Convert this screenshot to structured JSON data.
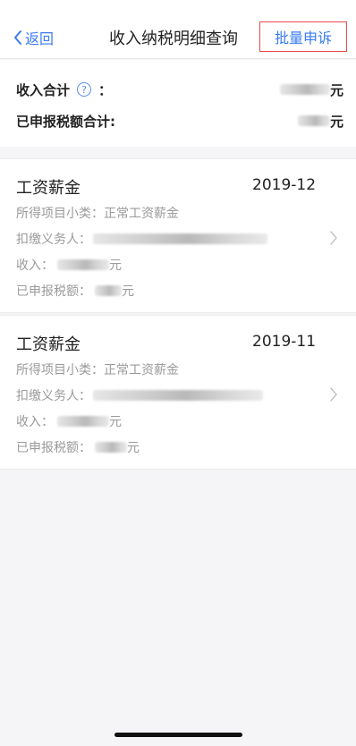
{
  "navbar": {
    "back_label": "返回",
    "title": "收入纳税明细查询",
    "action_label": "批量申诉"
  },
  "summary": {
    "income_total_label": "收入合计",
    "help_symbol": "?",
    "colon": "：",
    "declared_tax_total_label": "已申报税额合计:",
    "currency_unit": "元"
  },
  "records": [
    {
      "category": "工资薪金",
      "period": "2019-12",
      "subitem_label": "所得项目小类：",
      "subitem_value": "正常工资薪金",
      "withholder_label": "扣缴义务人：",
      "income_label": "收入：",
      "income_unit": "元",
      "declared_tax_label": "已申报税额：",
      "declared_tax_unit": "元"
    },
    {
      "category": "工资薪金",
      "period": "2019-11",
      "subitem_label": "所得项目小类：",
      "subitem_value": "正常工资薪金",
      "withholder_label": "扣缴义务人：",
      "income_label": "收入：",
      "income_unit": "元",
      "declared_tax_label": "已申报税额：",
      "declared_tax_unit": "元"
    }
  ],
  "colors": {
    "accent": "#3a7cf0",
    "highlight_border": "#e84a4a",
    "muted_text": "#9a9a9a",
    "background": "#f5f5f7"
  },
  "icons": {
    "back": "chevron-left-icon",
    "help": "question-circle-icon",
    "row_arrow": "chevron-right-icon"
  }
}
